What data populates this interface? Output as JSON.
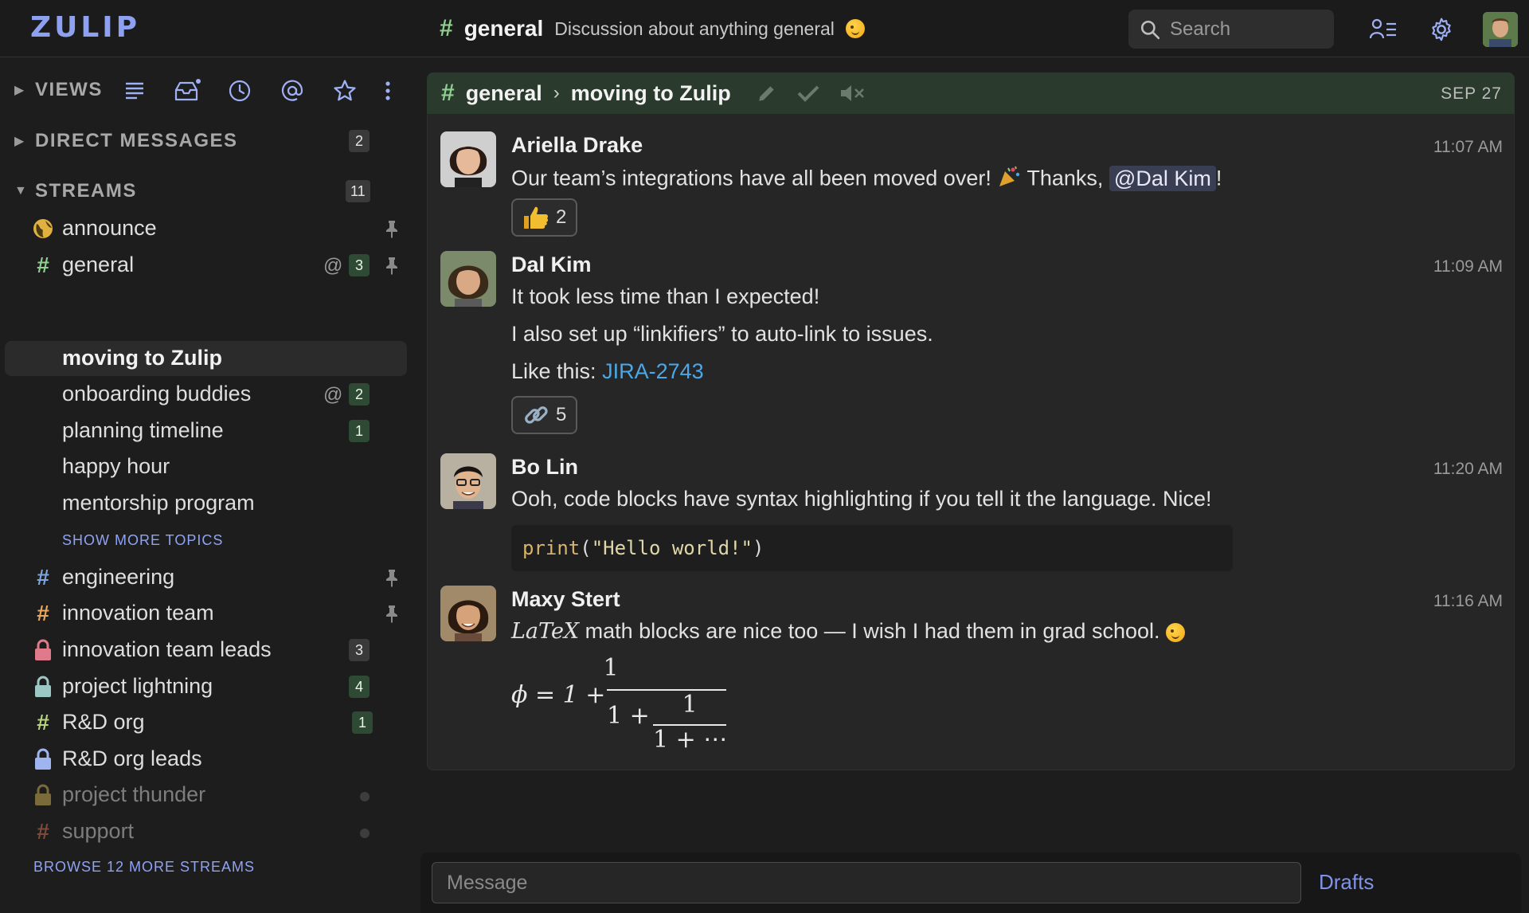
{
  "app": {
    "logo": "ZULIP"
  },
  "navbar": {
    "stream_name": "general",
    "stream_description": "Discussion about anything general",
    "search_placeholder": "Search"
  },
  "sidebar": {
    "views_label": "VIEWS",
    "direct_messages_label": "DIRECT MESSAGES",
    "direct_messages_count": "2",
    "streams_label": "STREAMS",
    "streams_count": "11",
    "streams": [
      {
        "name": "announce",
        "icon": "globe-icon",
        "pinned": true
      },
      {
        "name": "general",
        "icon": "hash-icon",
        "color": "#8fcf8f",
        "count": "3",
        "mention": true,
        "pinned": true
      },
      {
        "name": "engineering",
        "icon": "hash-icon",
        "color": "#7ca6e0",
        "pinned": true
      },
      {
        "name": "innovation team",
        "icon": "hash-icon",
        "color": "#e8a860",
        "pinned": true
      },
      {
        "name": "innovation team leads",
        "icon": "lock-icon",
        "color": "#e07a8a",
        "count": "3"
      },
      {
        "name": "project lightning",
        "icon": "lock-icon",
        "color": "#9cc8c4",
        "count": "4"
      },
      {
        "name": "R&D org",
        "icon": "hash-icon",
        "color": "#b7d47a",
        "count": "1"
      },
      {
        "name": "R&D org leads",
        "icon": "lock-icon",
        "color": "#9fb5f0"
      },
      {
        "name": "project thunder",
        "icon": "lock-icon",
        "color": "#7b6a3a"
      },
      {
        "name": "support",
        "icon": "hash-icon",
        "color": "#7a4a3a"
      }
    ],
    "topics": [
      {
        "name": "moving to Zulip",
        "active": true
      },
      {
        "name": "onboarding buddies",
        "count": "2",
        "mention": true
      },
      {
        "name": "planning timeline",
        "count": "1"
      },
      {
        "name": "happy hour"
      },
      {
        "name": "mentorship program"
      }
    ],
    "show_more_topics": "SHOW MORE TOPICS",
    "browse_more_streams": "BROWSE 12 MORE STREAMS"
  },
  "recipient": {
    "stream": "general",
    "topic": "moving to Zulip",
    "date": "SEP 27"
  },
  "messages": [
    {
      "sender": "Ariella Drake",
      "time": "11:07 AM",
      "text_before": "Our team’s integrations have all been moved over!",
      "text_after": " Thanks, ",
      "mention": "@Dal Kim",
      "text_end": "!",
      "reaction": {
        "emoji": "thumbs-up-icon",
        "count": "2"
      }
    },
    {
      "sender": "Dal Kim",
      "time": "11:09 AM",
      "line1": "It took less time than I expected!",
      "line2": "I also set up “linkifiers” to auto-link to issues.",
      "line3_prefix": "Like this: ",
      "line3_link": "JIRA-2743",
      "reaction": {
        "emoji": "link-icon",
        "count": "5"
      }
    },
    {
      "sender": "Bo Lin",
      "time": "11:20 AM",
      "text": "Ooh, code blocks have syntax highlighting if you tell it the language. Nice!",
      "code_fn": "print",
      "code_open": "(",
      "code_str": "\"Hello world!\"",
      "code_close": ")"
    },
    {
      "sender": "Maxy Stert",
      "time": "11:16 AM",
      "latex_word": "LaTeX",
      "text": " math blocks are nice too — I wish I had them in grad school.",
      "math": {
        "phi": "ϕ = 1 +",
        "num1": "1",
        "den_prefix": "1 +",
        "num2": "1",
        "den2": "1 + ⋯"
      }
    }
  ],
  "compose": {
    "placeholder": "Message",
    "drafts_label": "Drafts"
  }
}
